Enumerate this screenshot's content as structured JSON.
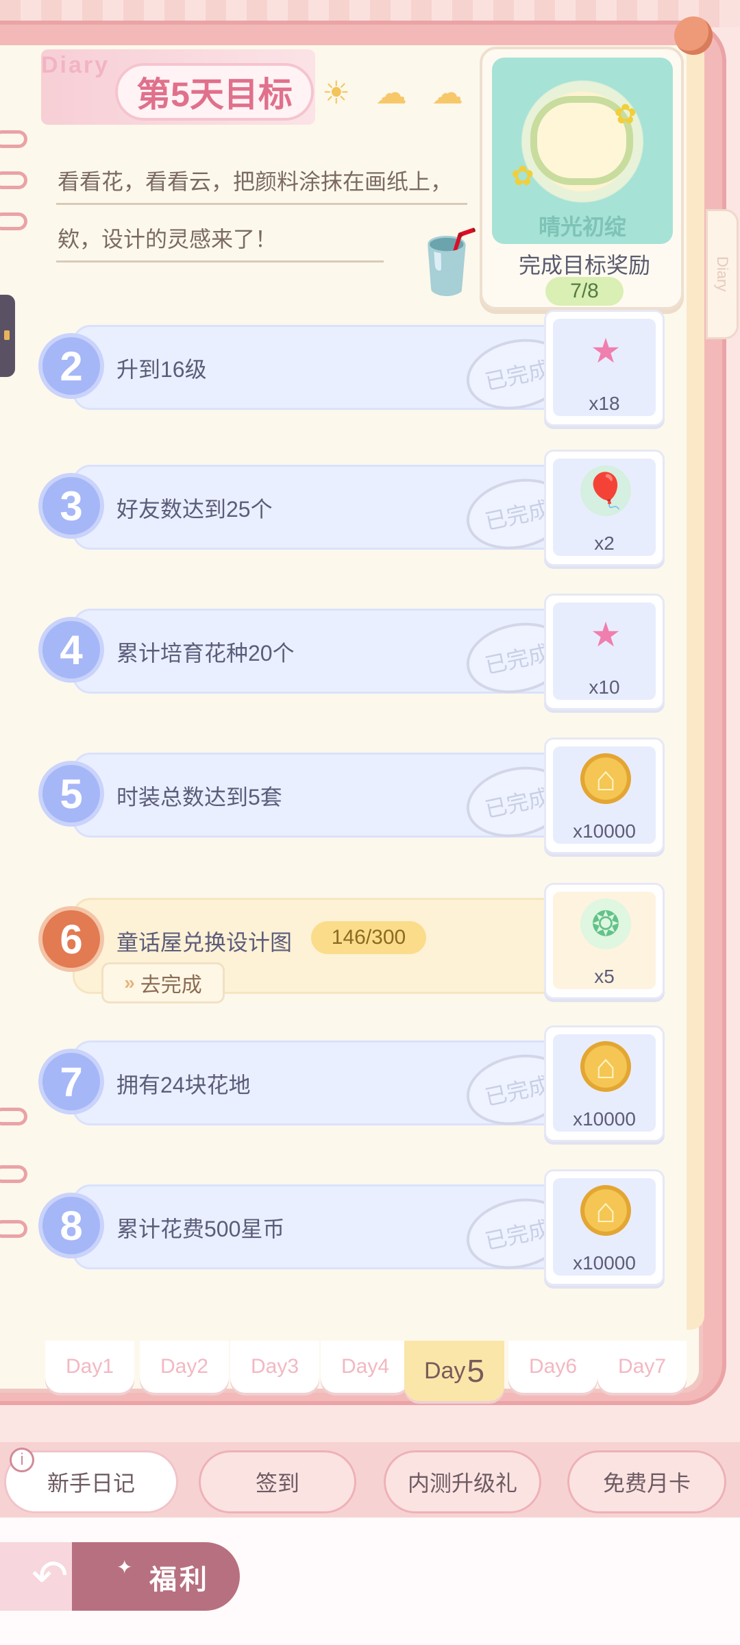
{
  "header": {
    "diary_word": "Diary",
    "title": "第5天目标",
    "story_line1": "看看花，看看云，把颜料涂抹在画纸上，",
    "story_line2": "欸，设计的灵感来了！",
    "side_tab": "Diary"
  },
  "reward": {
    "name": "晴光初绽",
    "label": "完成目标奖励",
    "count": "7/8"
  },
  "tasks": [
    {
      "num": "2",
      "label": "升到16级",
      "status": "已完成",
      "qty": "x18",
      "icon": "star-icon"
    },
    {
      "num": "3",
      "label": "好友数达到25个",
      "status": "已完成",
      "qty": "x2",
      "icon": "balloon-icon"
    },
    {
      "num": "4",
      "label": "累计培育花种20个",
      "status": "已完成",
      "qty": "x10",
      "icon": "star-icon"
    },
    {
      "num": "5",
      "label": "时装总数达到5套",
      "status": "已完成",
      "qty": "x10000",
      "icon": "coin-icon"
    },
    {
      "num": "6",
      "label": "童话屋兑换设计图",
      "progress": "146/300",
      "go": "去完成",
      "qty": "x5",
      "icon": "card-icon"
    },
    {
      "num": "7",
      "label": "拥有24块花地",
      "status": "已完成",
      "qty": "x10000",
      "icon": "coin-icon"
    },
    {
      "num": "8",
      "label": "累计花费500星币",
      "status": "已完成",
      "qty": "x10000",
      "icon": "coin-icon"
    }
  ],
  "days": [
    "Day1",
    "Day2",
    "Day3",
    "Day4",
    "Day",
    "Day6",
    "Day7"
  ],
  "active_day_num": "5",
  "nav": [
    "新手日记",
    "签到",
    "内测升级礼",
    "免费月卡"
  ],
  "welfare": "福利",
  "colors": {
    "accent": "#e0708b",
    "task_bg": "#e9efff",
    "active_task": "#fdf1d6"
  }
}
